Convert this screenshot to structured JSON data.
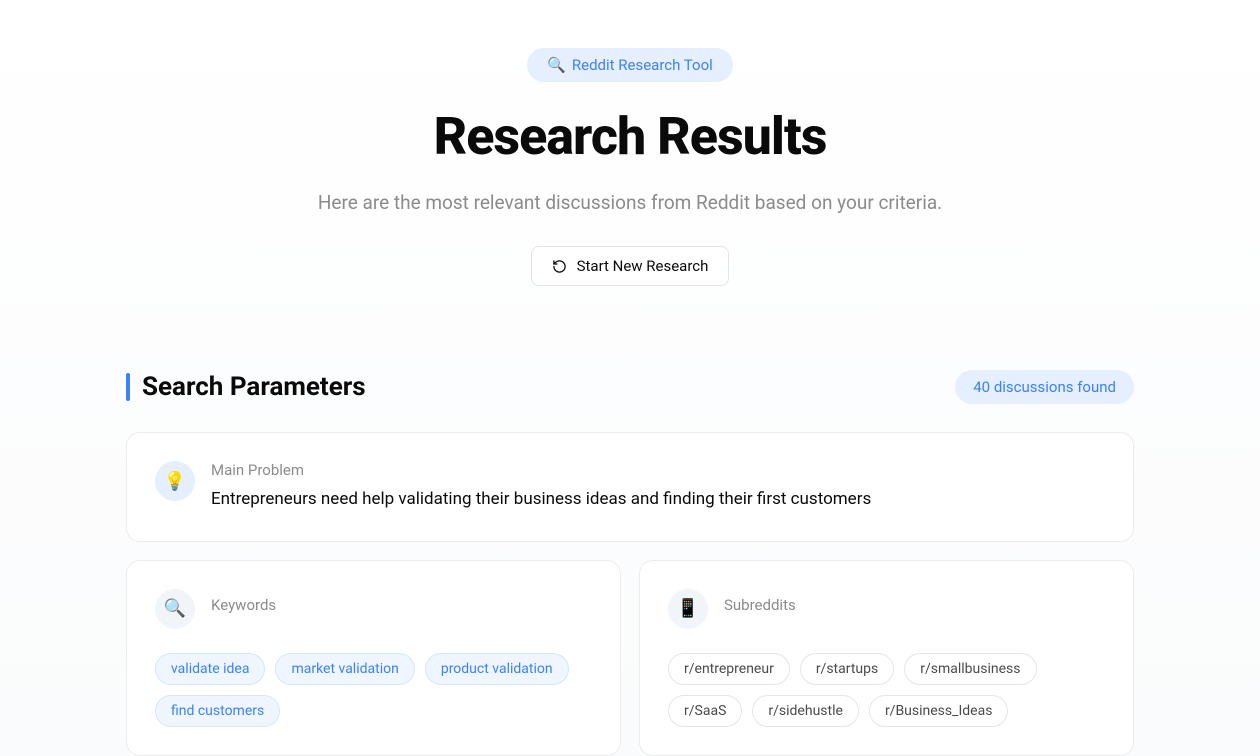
{
  "header": {
    "badge_text": "Reddit Research Tool",
    "title": "Research Results",
    "subtitle": "Here are the most relevant discussions from Reddit based on your criteria.",
    "new_research_label": "Start New Research"
  },
  "params": {
    "section_title": "Search Parameters",
    "count_badge": "40 discussions found",
    "main_problem": {
      "label": "Main Problem",
      "text": "Entrepreneurs need help validating their business ideas and finding their first customers"
    },
    "keywords": {
      "label": "Keywords",
      "items": [
        "validate idea",
        "market validation",
        "product validation",
        "find customers"
      ]
    },
    "subreddits": {
      "label": "Subreddits",
      "items": [
        "r/entrepreneur",
        "r/startups",
        "r/smallbusiness",
        "r/SaaS",
        "r/sidehustle",
        "r/Business_Ideas"
      ]
    }
  }
}
